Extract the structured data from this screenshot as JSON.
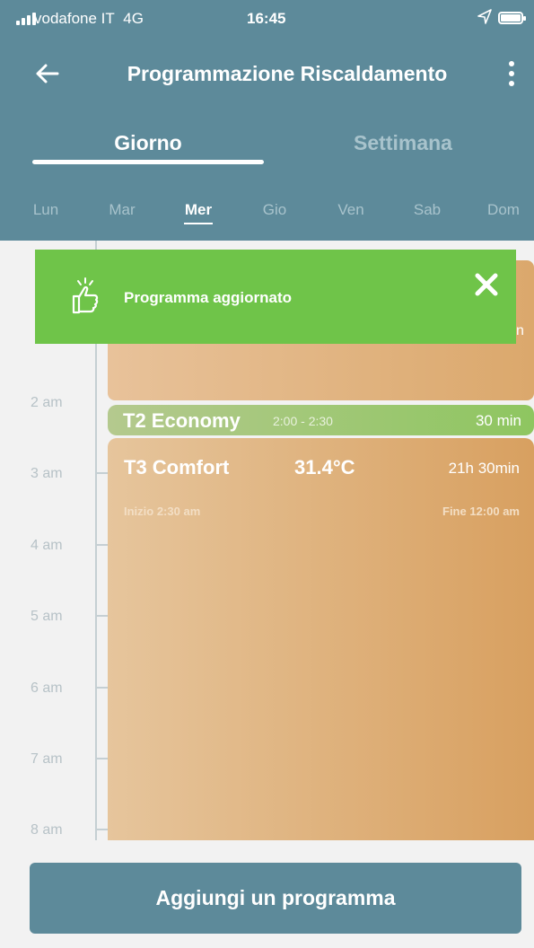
{
  "status_bar": {
    "carrier": "vodafone IT",
    "network": "4G",
    "time": "16:45"
  },
  "nav": {
    "title": "Programmazione Riscaldamento",
    "back_icon": "arrow-left-icon",
    "menu_icon": "more-vertical-icon"
  },
  "tabs": [
    {
      "label": "Giorno",
      "active": true
    },
    {
      "label": "Settimana",
      "active": false
    }
  ],
  "days": [
    {
      "label": "Lun",
      "active": false
    },
    {
      "label": "Mar",
      "active": false
    },
    {
      "label": "Mer",
      "active": true
    },
    {
      "label": "Gio",
      "active": false
    },
    {
      "label": "Ven",
      "active": false
    },
    {
      "label": "Sab",
      "active": false
    },
    {
      "label": "Dom",
      "active": false
    }
  ],
  "timeline": {
    "hours": [
      "2 am",
      "3 am",
      "4 am",
      "5 am",
      "6 am",
      "7 am",
      "8 am"
    ]
  },
  "programs": {
    "economy": {
      "name": "T2 Economy",
      "range": "2:00 - 2:30",
      "duration": "30 min"
    },
    "comfort": {
      "name": "T3 Comfort",
      "temperature": "31.4°C",
      "duration": "21h 30min",
      "start": "Inizio 2:30 am",
      "end": "Fine 12:00 am"
    }
  },
  "toast": {
    "message": "Programma aggiornato",
    "peek_text": "n",
    "icon": "thumbs-up-icon",
    "close_icon": "close-icon"
  },
  "add_button": {
    "label": "Aggiungi un programma"
  },
  "colors": {
    "header": "#5d8a9a",
    "toast": "#6fc449",
    "comfort": "#d8a060",
    "economy": "#8ec660"
  }
}
